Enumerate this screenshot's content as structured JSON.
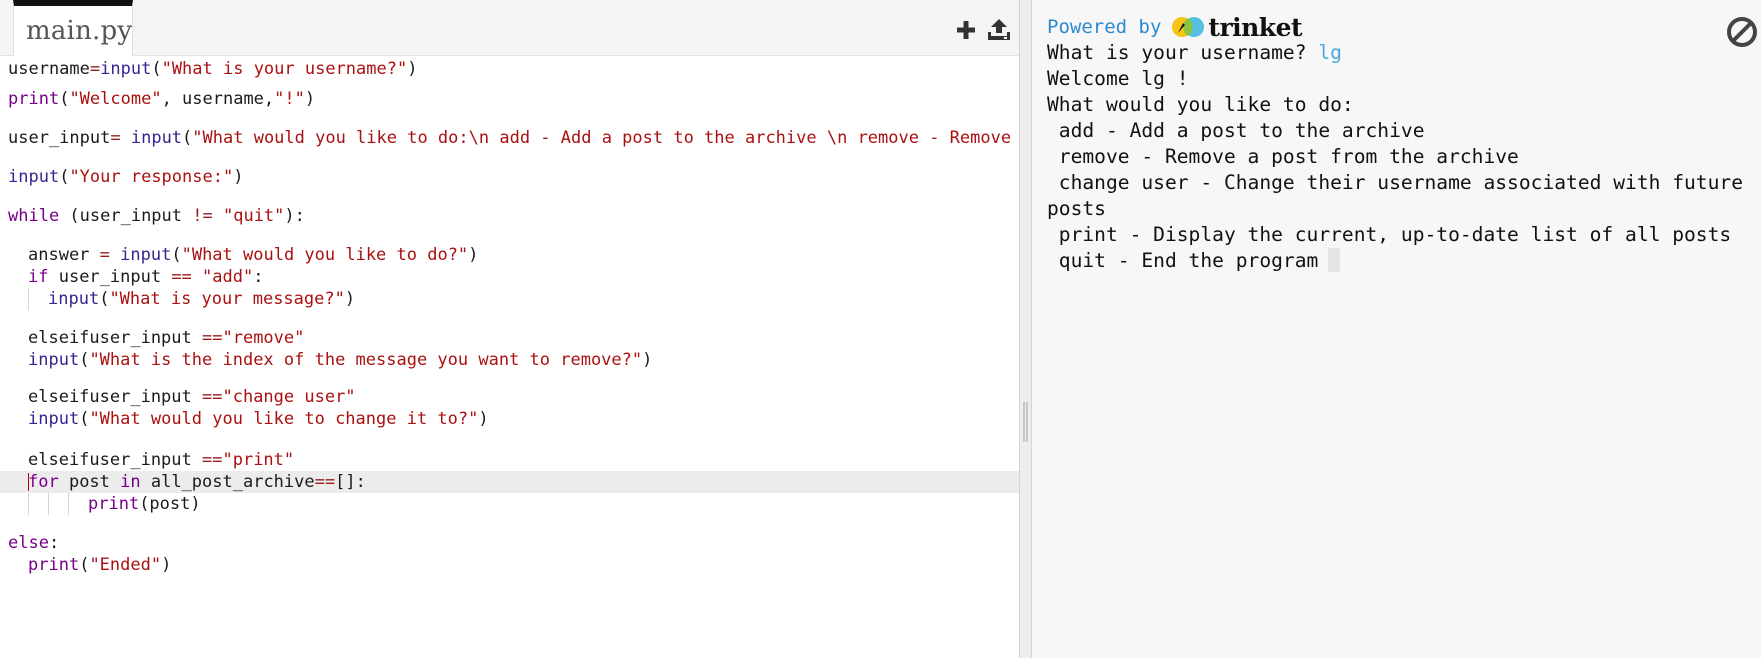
{
  "editor": {
    "file_tab": "main.py",
    "code": {
      "l1": [
        "username",
        "=",
        "input",
        "(",
        "\"What is your username?\"",
        ")"
      ],
      "l2": [
        "print",
        "(",
        "\"Welcome\"",
        ", username,",
        "\"!\"",
        ")"
      ],
      "l3": [
        "user_input",
        "=",
        " ",
        "input",
        "(",
        "\"What would you like to do:\\n add - Add a post to the archive \\n remove - Remove a post from the archive \\n change user - Change their username associated with future posts \\n print - Display the current, up-to-date list of all posts \\n quit - End the program \")"
      ],
      "l4": [
        "input",
        "(",
        "\"Your response:\"",
        ")"
      ],
      "l5": [
        "while",
        " (user_input ",
        "!=",
        " ",
        "\"quit\"",
        "):"
      ],
      "l6": [
        "answer ",
        "=",
        " ",
        "input",
        "(",
        "\"What would you like to do?\"",
        ")"
      ],
      "l7": [
        "if",
        " user_input ",
        "==",
        " ",
        "\"add\"",
        ":"
      ],
      "l8": [
        "input",
        "(",
        "\"What is your message?\"",
        ")"
      ],
      "l9": [
        "elseifuser_input ",
        "==",
        "\"remove\""
      ],
      "l10": [
        "input",
        "(",
        "\"What is the index of the message you want to remove?\"",
        ")"
      ],
      "l11": [
        "elseifuser_input ",
        "==",
        "\"change user\""
      ],
      "l12": [
        "input",
        "(",
        "\"What would you like to change it to?\"",
        ")"
      ],
      "l13": [
        "elseifuser_input ",
        "==",
        "\"print\""
      ],
      "l14": [
        "for",
        " post ",
        "in",
        " all_post_archive",
        "==",
        "[]:"
      ],
      "l15": [
        "print",
        "(post)"
      ],
      "l16": [
        "else",
        ":"
      ],
      "l17": [
        "print",
        "(",
        "\"Ended\"",
        ")"
      ]
    }
  },
  "output": {
    "powered_by": "Powered by",
    "brand": "trinket",
    "lines": {
      "l1_prompt": "What is your username? ",
      "l1_input": "lg",
      "l2": "Welcome lg !",
      "l3": "What would you like to do:",
      "l4": " add - Add a post to the archive",
      "l5": " remove - Remove a post from the archive",
      "l6": " change user - Change their username associated with future",
      "l7": "posts",
      "l8": " print - Display the current, up-to-date list of all posts",
      "l9": " quit - End the program"
    }
  },
  "icons": {
    "add_file": "plus-icon",
    "upload": "upload-icon",
    "stop": "stop-icon",
    "logo": "trinket-logo-icon"
  },
  "colors": {
    "keyword": "#770088",
    "string": "#aa1111",
    "function": "#3a2290",
    "powered_by": "#2c8acf",
    "user_input": "#4aa8de"
  }
}
